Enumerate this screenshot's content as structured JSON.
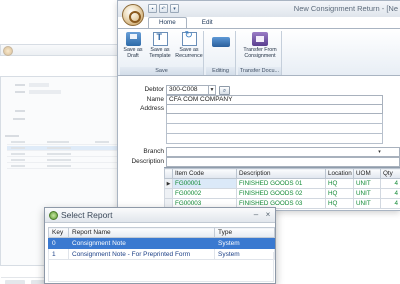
{
  "main_window": {
    "title": "New Consignment Return - [Ne",
    "tabs": [
      {
        "label": "Home",
        "active": true
      },
      {
        "label": "Edit",
        "active": false
      }
    ],
    "ribbon": {
      "groups": [
        {
          "label": "Save",
          "buttons": [
            {
              "line1": "Save as",
              "line2": "Draft",
              "icon": "save-draft-icon"
            },
            {
              "line1": "Save as",
              "line2": "Template",
              "icon": "template-icon"
            },
            {
              "line1": "Save as",
              "line2": "Recurrence",
              "icon": "recurrence-icon"
            }
          ]
        },
        {
          "label": "Editing",
          "buttons": [
            {
              "icon": "edit-icon"
            }
          ]
        },
        {
          "label": "Transfer Docu...",
          "buttons": [
            {
              "line1": "Transfer From",
              "line2": "Consignment",
              "icon": "transfer-icon"
            }
          ]
        }
      ]
    },
    "form": {
      "debtor_label": "Debtor",
      "debtor_value": "300-C008",
      "name_label": "Name",
      "name_value": "CFA COM COMPANY",
      "address_label": "Address",
      "branch_label": "Branch",
      "description_label": "Description"
    },
    "grid": {
      "columns": [
        "Item Code",
        "Description",
        "Location",
        "UOM",
        "Qty"
      ],
      "rows": [
        {
          "code": "FG00001",
          "description": "FINISHED GOODS 01",
          "location": "HQ",
          "uom": "UNIT",
          "qty": "4"
        },
        {
          "code": "FG00002",
          "description": "FINISHED GOODS 02",
          "location": "HQ",
          "uom": "UNIT",
          "qty": "4"
        },
        {
          "code": "FG00003",
          "description": "FINISHED GOODS 03",
          "location": "HQ",
          "uom": "UNIT",
          "qty": "4"
        }
      ]
    }
  },
  "dialog": {
    "title": "Select Report",
    "controls": {
      "minimize": "–",
      "close": "×"
    },
    "columns": [
      "Key",
      "Report Name",
      "Type"
    ],
    "rows": [
      {
        "key": "0",
        "name": "Consignment Note",
        "type": "System",
        "selected": true
      },
      {
        "key": "1",
        "name": "Consignment Note - For Preprinted Form",
        "type": "System",
        "selected": false
      }
    ]
  },
  "colors": {
    "accent": "#3a79d0",
    "item_text": "#128a35",
    "report_text": "#1b3f86"
  }
}
